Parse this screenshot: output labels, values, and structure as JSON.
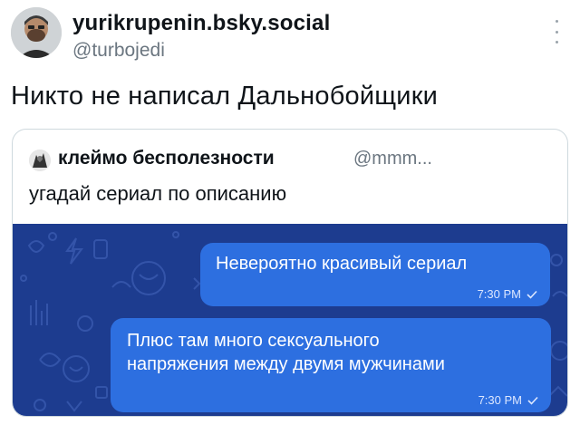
{
  "author": {
    "display_name": "yurikrupenin.bsky.social",
    "handle": "@turbojedi"
  },
  "post": {
    "text": "Никто не написал Дальнобойщики"
  },
  "quoted_post": {
    "author_name": "клеймо бесполезности",
    "author_handle": "@mmm...",
    "text": "угадай сериал по описанию",
    "media": {
      "messages": [
        {
          "text": "Невероятно красивый сериал",
          "time": "7:30 PM"
        },
        {
          "text": "Плюс там много сексуального\nнапряжения между двумя мужчинами",
          "time": "7:30 PM"
        }
      ],
      "background_color": "#1d3c8f",
      "bubble_color": "#2d6fe0"
    }
  },
  "icons": {
    "more": "more-vertical-icon",
    "check": "single-check-icon"
  }
}
